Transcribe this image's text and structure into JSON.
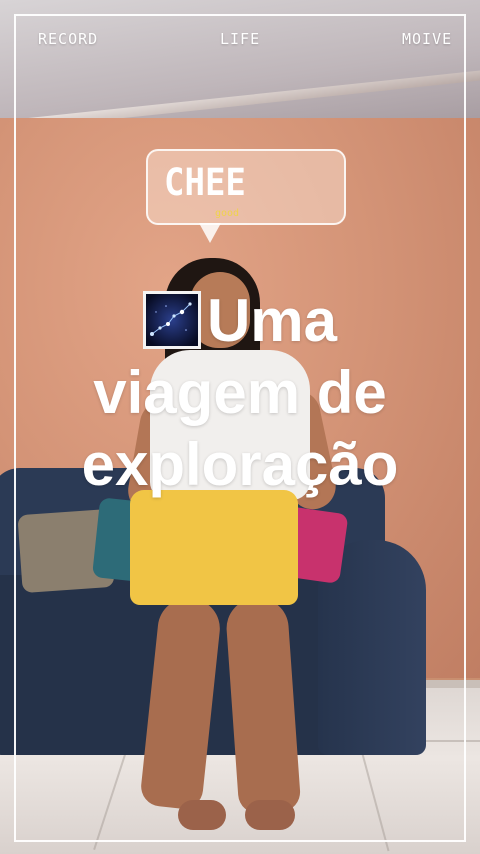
{
  "header": {
    "left_label": "RECORD",
    "center_label": "LIFE",
    "right_label": "MOIVE"
  },
  "bubble": {
    "title": "CHEE",
    "subtitle": "good"
  },
  "caption": {
    "emoji": "night-sky-icon",
    "line1": "Uma",
    "line2": "viagem de",
    "line3": "exploração"
  },
  "colors": {
    "overlay_text": "#ffffff",
    "bubble_subtitle": "#f0d34b",
    "wall": "#d49477",
    "shorts": "#f1c545",
    "sofa": "#2b3a55"
  }
}
